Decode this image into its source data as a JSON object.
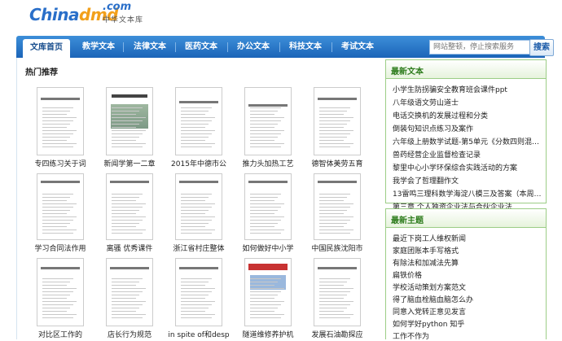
{
  "logo": {
    "main_prefix": "China",
    "main_styled": "dmd",
    "com": ".com",
    "cn": "中华文本库"
  },
  "nav": {
    "items": [
      {
        "label": "文库首页",
        "active": true
      },
      {
        "label": "教学文本"
      },
      {
        "label": "法律文本"
      },
      {
        "label": "医药文本"
      },
      {
        "label": "办公文本"
      },
      {
        "label": "科技文本"
      },
      {
        "label": "考试文本"
      }
    ],
    "search_placeholder": "网站整顿，停止搜索服务",
    "search_button": "搜索"
  },
  "main": {
    "title": "热门推荐",
    "docs": [
      "专四练习关于词",
      "新闻学第一二章",
      "2015年中德市公",
      "推力头加热工艺",
      "德智体美劳五育",
      "学习合同法作用",
      "离骚 优秀课件",
      "浙江省村庄整体",
      "如何做好中小学",
      "中国民族沈阳市",
      "对比区工作的",
      "店长行为规范",
      "in spite of和desp",
      "隧道维修养护机",
      "发展石油勘探应"
    ]
  },
  "latest": {
    "title": "最新文本",
    "items": [
      "小学生防拐骗安全教育班会课件ppt",
      "八年级语文劳山道士",
      "电话交换机的发展过程和分类",
      "倒装句知识点练习及案作",
      "六年级上册数学试题-第5单元《分数四则混合运算》…",
      "兽药经营企业监督检查记录",
      "黎里中心小学环保综合实践活动的方案",
      "我学会了哲理翻作文",
      "13雷鸣三理科数学海淀八模三及答案（本周末作…",
      "第三章 个人独资企业法与合伙企业法"
    ]
  },
  "topics": {
    "title": "最新主题",
    "items": [
      "最近下岗工人维权新闻",
      "家庭团账本手写格式",
      "有除法和加减法先算",
      "扁铁价格",
      "学校活动策划方案范文",
      "得了脑血栓脑血脑怎么办",
      "同意入党转正意见发言",
      "如何学好python 知乎",
      "工作不作为"
    ]
  }
}
